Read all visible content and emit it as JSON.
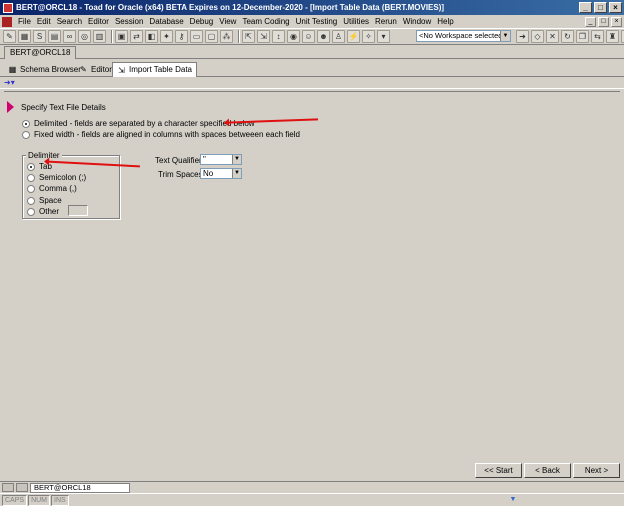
{
  "window": {
    "title": "BERT@ORCL18 - Toad for Oracle (x64)  BETA Expires on 12-December-2020 - [Import Table Data (BERT.MOVIES)]",
    "min": "_",
    "max": "□",
    "close": "×"
  },
  "menu": [
    "File",
    "Edit",
    "Search",
    "Editor",
    "Session",
    "Database",
    "Debug",
    "View",
    "Team Coding",
    "Unit Testing",
    "Utilities",
    "Rerun",
    "Window",
    "Help"
  ],
  "workspace": {
    "value": "<No Workspace selected>"
  },
  "connection_tab": "BERT@ORCL18",
  "doc_tabs": [
    "Schema Browser",
    "Editor",
    "Import Table Data"
  ],
  "wizard": {
    "step_title": "Specify Text File Details",
    "option_delimited": "Delimited - fields are separated by a character specified below",
    "option_fixed": "Fixed width - fields are aligned in columns with spaces betweeen each field",
    "delimiter_group": "Delimiter",
    "delimiters": [
      "Tab",
      "Semicolon (;)",
      "Comma (,)",
      "Space",
      "Other"
    ],
    "text_qualifier_label": "Text Qualifier:",
    "text_qualifier_value": "\"",
    "trim_spaces_label": "Trim Spaces:",
    "trim_spaces_value": "No",
    "btn_start": "<< Start",
    "btn_back": "< Back",
    "btn_next": "Next >"
  },
  "taskbar": {
    "connection": "BERT@ORCL18"
  },
  "status": {
    "caps": "CAPS",
    "num": "NUM",
    "ins": "INS"
  }
}
